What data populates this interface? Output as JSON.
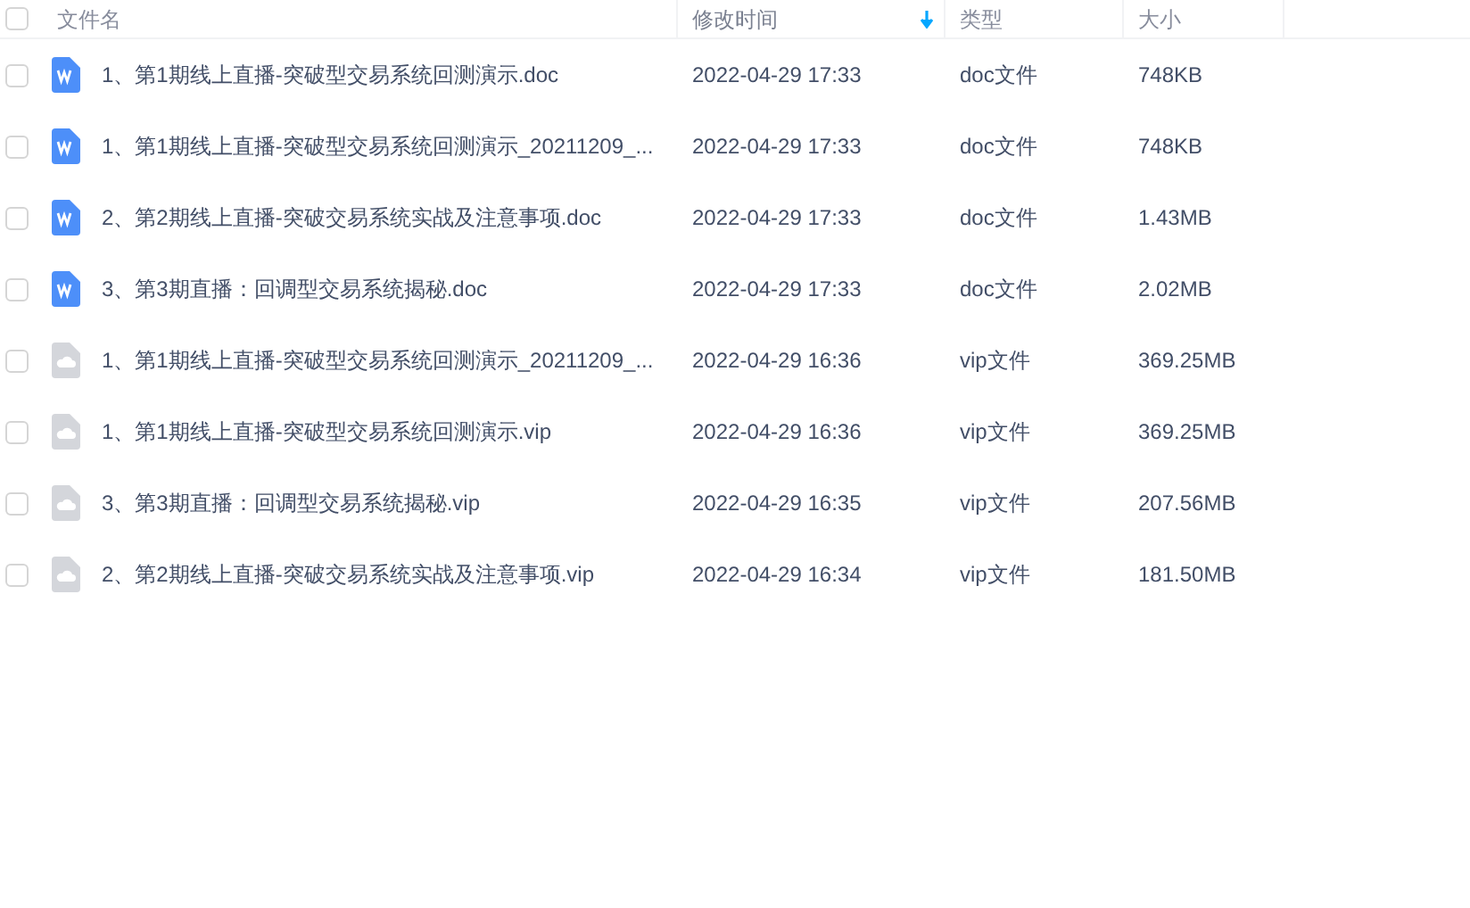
{
  "header": {
    "checked": false,
    "columns": [
      {
        "label": "文件名",
        "sorted": false
      },
      {
        "label": "修改时间",
        "sorted": true
      },
      {
        "label": "类型",
        "sorted": false
      },
      {
        "label": "大小",
        "sorted": false
      }
    ]
  },
  "rows": [
    {
      "kind": "doc",
      "checked": false,
      "name": "1、第1期线上直播-突破型交易系统回测演示.doc",
      "modified": "2022-04-29 17:33",
      "type": "doc文件",
      "size": "748KB"
    },
    {
      "kind": "doc",
      "checked": false,
      "name": "1、第1期线上直播-突破型交易系统回测演示_20211209_...",
      "modified": "2022-04-29 17:33",
      "type": "doc文件",
      "size": "748KB"
    },
    {
      "kind": "doc",
      "checked": false,
      "name": "2、第2期线上直播-突破交易系统实战及注意事项.doc",
      "modified": "2022-04-29 17:33",
      "type": "doc文件",
      "size": "1.43MB"
    },
    {
      "kind": "doc",
      "checked": false,
      "name": "3、第3期直播：回调型交易系统揭秘.doc",
      "modified": "2022-04-29 17:33",
      "type": "doc文件",
      "size": "2.02MB"
    },
    {
      "kind": "vip",
      "checked": false,
      "name": "1、第1期线上直播-突破型交易系统回测演示_20211209_...",
      "modified": "2022-04-29 16:36",
      "type": "vip文件",
      "size": "369.25MB"
    },
    {
      "kind": "vip",
      "checked": false,
      "name": "1、第1期线上直播-突破型交易系统回测演示.vip",
      "modified": "2022-04-29 16:36",
      "type": "vip文件",
      "size": "369.25MB"
    },
    {
      "kind": "vip",
      "checked": false,
      "name": "3、第3期直播：回调型交易系统揭秘.vip",
      "modified": "2022-04-29 16:35",
      "type": "vip文件",
      "size": "207.56MB"
    },
    {
      "kind": "vip",
      "checked": false,
      "name": "2、第2期线上直播-突破交易系统实战及注意事项.vip",
      "modified": "2022-04-29 16:34",
      "type": "vip文件",
      "size": "181.50MB"
    }
  ]
}
